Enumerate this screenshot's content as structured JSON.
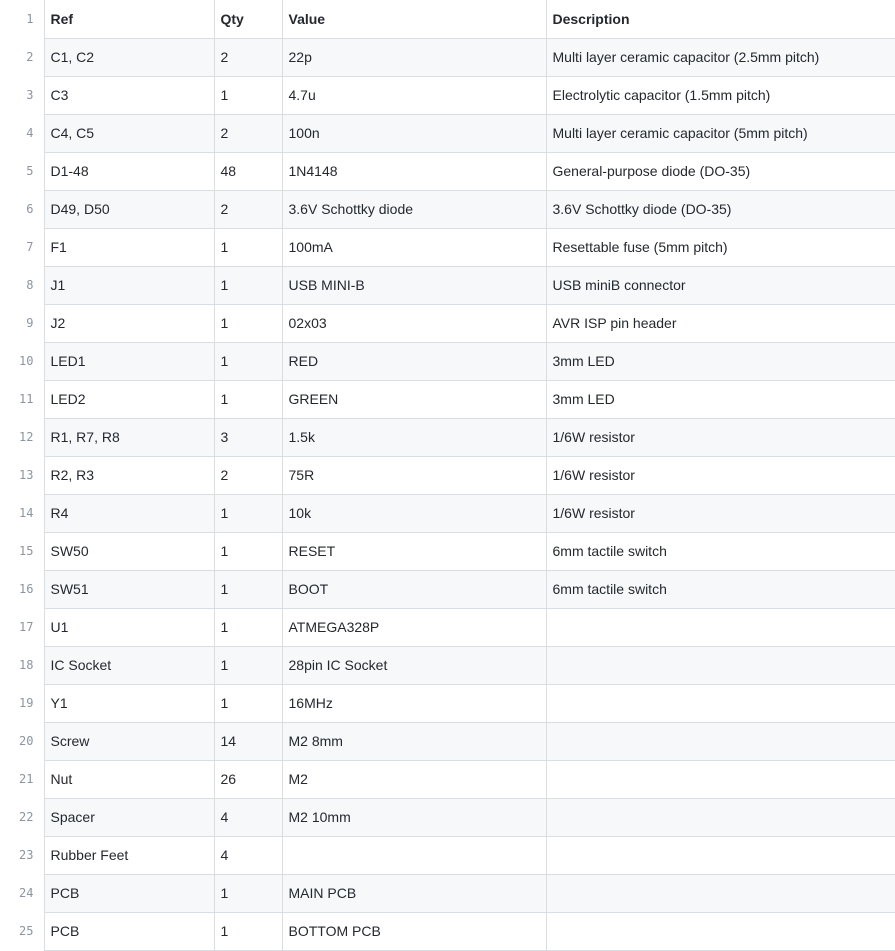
{
  "header": {
    "line": "1",
    "ref": "Ref",
    "qty": "Qty",
    "value": "Value",
    "description": "Description"
  },
  "rows": [
    {
      "line": "2",
      "ref": "C1, C2",
      "qty": "2",
      "value": "22p",
      "description": "Multi layer ceramic capacitor (2.5mm pitch)"
    },
    {
      "line": "3",
      "ref": "C3",
      "qty": "1",
      "value": "4.7u",
      "description": "Electrolytic capacitor (1.5mm pitch)"
    },
    {
      "line": "4",
      "ref": "C4, C5",
      "qty": "2",
      "value": "100n",
      "description": "Multi layer ceramic capacitor (5mm pitch)"
    },
    {
      "line": "5",
      "ref": "D1-48",
      "qty": "48",
      "value": "1N4148",
      "description": "General-purpose diode (DO-35)"
    },
    {
      "line": "6",
      "ref": "D49, D50",
      "qty": "2",
      "value": "3.6V Schottky diode",
      "description": "3.6V Schottky diode (DO-35)"
    },
    {
      "line": "7",
      "ref": "F1",
      "qty": "1",
      "value": "100mA",
      "description": "Resettable fuse (5mm pitch)"
    },
    {
      "line": "8",
      "ref": "J1",
      "qty": "1",
      "value": "USB MINI-B",
      "description": "USB miniB connector"
    },
    {
      "line": "9",
      "ref": "J2",
      "qty": "1",
      "value": "02x03",
      "description": "AVR ISP pin header"
    },
    {
      "line": "10",
      "ref": "LED1",
      "qty": "1",
      "value": "RED",
      "description": "3mm LED"
    },
    {
      "line": "11",
      "ref": "LED2",
      "qty": "1",
      "value": "GREEN",
      "description": "3mm LED"
    },
    {
      "line": "12",
      "ref": "R1, R7, R8",
      "qty": "3",
      "value": "1.5k",
      "description": "1/6W resistor"
    },
    {
      "line": "13",
      "ref": "R2, R3",
      "qty": "2",
      "value": "75R",
      "description": "1/6W resistor"
    },
    {
      "line": "14",
      "ref": "R4",
      "qty": "1",
      "value": "10k",
      "description": "1/6W resistor"
    },
    {
      "line": "15",
      "ref": "SW50",
      "qty": "1",
      "value": "RESET",
      "description": "6mm tactile switch"
    },
    {
      "line": "16",
      "ref": "SW51",
      "qty": "1",
      "value": "BOOT",
      "description": "6mm tactile switch"
    },
    {
      "line": "17",
      "ref": "U1",
      "qty": "1",
      "value": "ATMEGA328P",
      "description": ""
    },
    {
      "line": "18",
      "ref": "IC Socket",
      "qty": "1",
      "value": "28pin IC Socket",
      "description": ""
    },
    {
      "line": "19",
      "ref": "Y1",
      "qty": "1",
      "value": "16MHz",
      "description": ""
    },
    {
      "line": "20",
      "ref": "Screw",
      "qty": "14",
      "value": "M2 8mm",
      "description": ""
    },
    {
      "line": "21",
      "ref": "Nut",
      "qty": "26",
      "value": "M2",
      "description": ""
    },
    {
      "line": "22",
      "ref": "Spacer",
      "qty": "4",
      "value": "M2 10mm",
      "description": ""
    },
    {
      "line": "23",
      "ref": "Rubber Feet",
      "qty": "4",
      "value": "",
      "description": ""
    },
    {
      "line": "24",
      "ref": "PCB",
      "qty": "1",
      "value": "MAIN PCB",
      "description": ""
    },
    {
      "line": "25",
      "ref": "PCB",
      "qty": "1",
      "value": "BOTTOM PCB",
      "description": ""
    }
  ]
}
